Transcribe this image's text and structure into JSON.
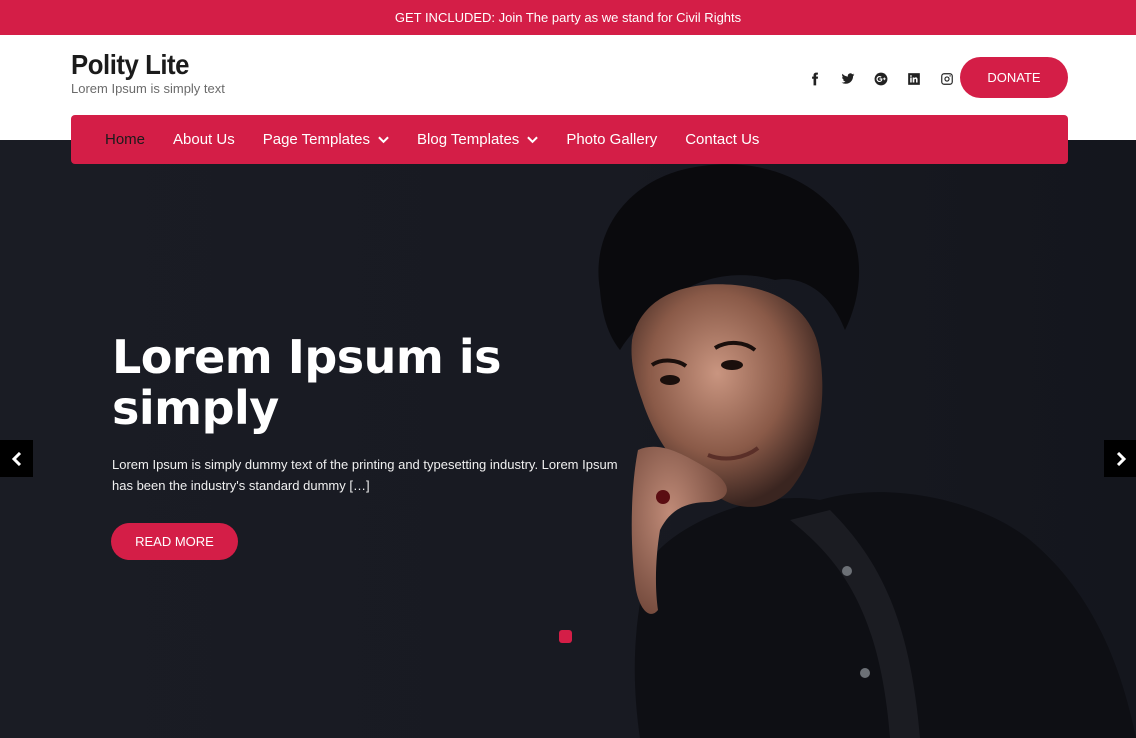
{
  "topbar": {
    "text": "GET INCLUDED: Join The party as we stand for Civil Rights"
  },
  "header": {
    "site_title": "Polity Lite",
    "tagline": "Lorem Ipsum is simply text",
    "donate_label": "DONATE",
    "socials": [
      "facebook-icon",
      "twitter-icon",
      "google-plus-icon",
      "linkedin-icon",
      "instagram-icon"
    ]
  },
  "nav": {
    "items": [
      {
        "label": "Home",
        "active": true
      },
      {
        "label": "About Us"
      },
      {
        "label": "Page Templates",
        "dropdown": true
      },
      {
        "label": "Blog Templates",
        "dropdown": true
      },
      {
        "label": "Photo Gallery"
      },
      {
        "label": "Contact Us"
      }
    ]
  },
  "hero": {
    "title": "Lorem Ipsum is simply",
    "text": "Lorem Ipsum is simply dummy text of the printing and typesetting industry. Lorem Ipsum has been the industry's standard dummy […]",
    "button_label": "READ MORE"
  },
  "colors": {
    "accent": "#d41e47",
    "hero_bg": "#181a22"
  }
}
